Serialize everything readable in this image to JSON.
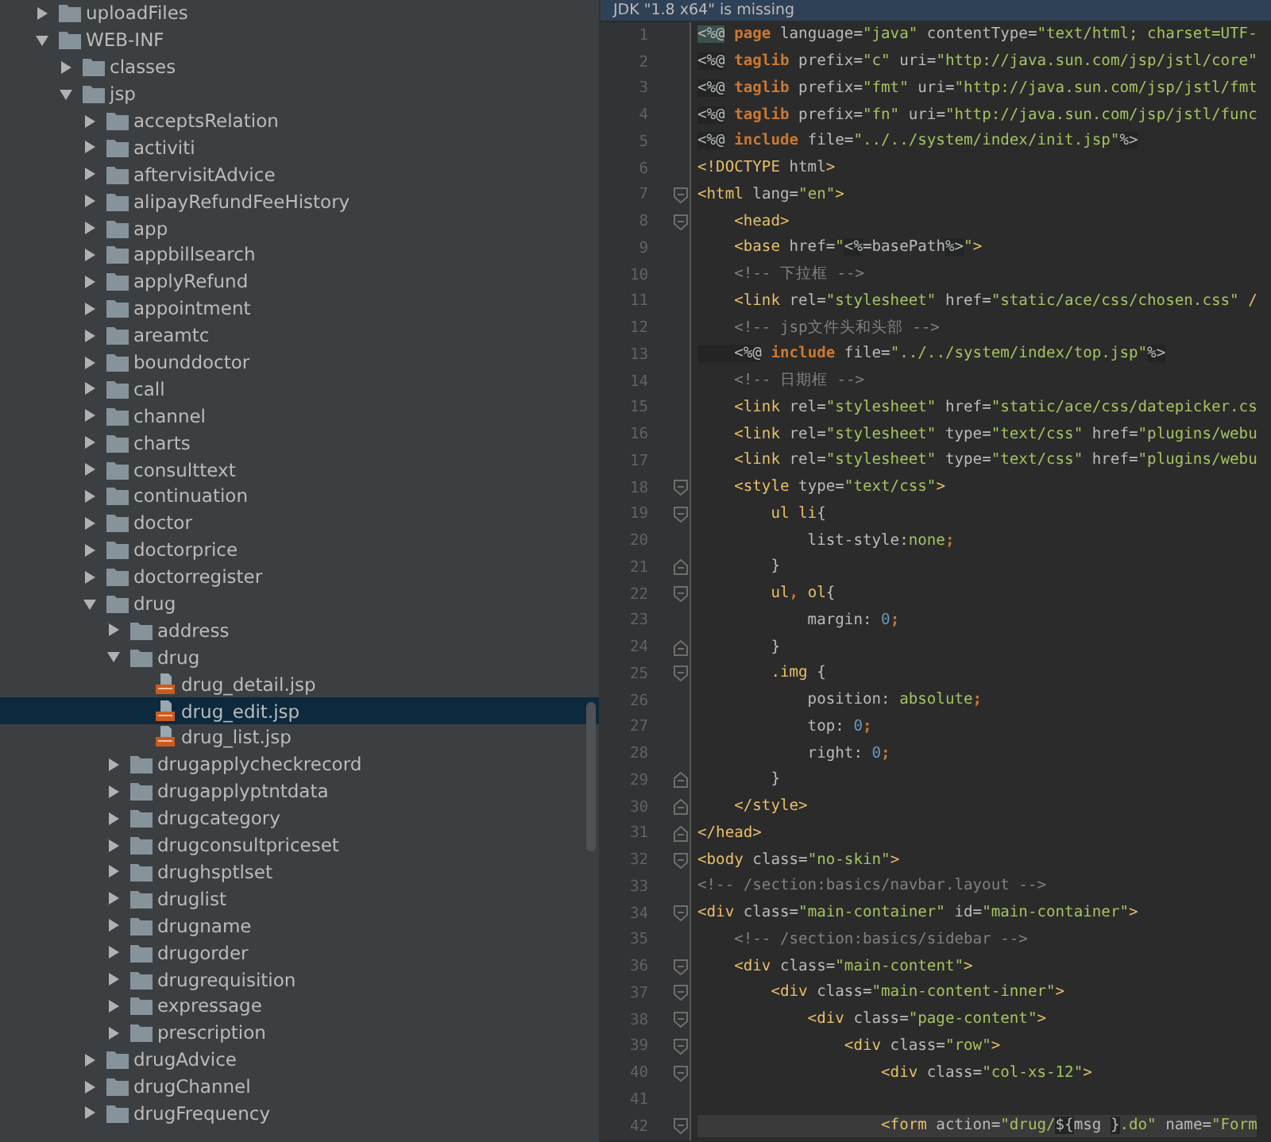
{
  "project_tree": {
    "items": [
      {
        "name": "uploadFiles",
        "kind": "folder",
        "expanded": false,
        "selected": false
      },
      {
        "name": "WEB-INF",
        "kind": "folder",
        "expanded": true,
        "selected": false,
        "children": [
          {
            "name": "classes",
            "kind": "folder",
            "expanded": false,
            "selected": false
          },
          {
            "name": "jsp",
            "kind": "folder",
            "expanded": true,
            "selected": false,
            "children": [
              {
                "name": "acceptsRelation",
                "kind": "folder",
                "expanded": false,
                "selected": false
              },
              {
                "name": "activiti",
                "kind": "folder",
                "expanded": false,
                "selected": false
              },
              {
                "name": "aftervisitAdvice",
                "kind": "folder",
                "expanded": false,
                "selected": false
              },
              {
                "name": "alipayRefundFeeHistory",
                "kind": "folder",
                "expanded": false,
                "selected": false
              },
              {
                "name": "app",
                "kind": "folder",
                "expanded": false,
                "selected": false
              },
              {
                "name": "appbillsearch",
                "kind": "folder",
                "expanded": false,
                "selected": false
              },
              {
                "name": "applyRefund",
                "kind": "folder",
                "expanded": false,
                "selected": false
              },
              {
                "name": "appointment",
                "kind": "folder",
                "expanded": false,
                "selected": false
              },
              {
                "name": "areamtc",
                "kind": "folder",
                "expanded": false,
                "selected": false
              },
              {
                "name": "bounddoctor",
                "kind": "folder",
                "expanded": false,
                "selected": false
              },
              {
                "name": "call",
                "kind": "folder",
                "expanded": false,
                "selected": false
              },
              {
                "name": "channel",
                "kind": "folder",
                "expanded": false,
                "selected": false
              },
              {
                "name": "charts",
                "kind": "folder",
                "expanded": false,
                "selected": false
              },
              {
                "name": "consulttext",
                "kind": "folder",
                "expanded": false,
                "selected": false
              },
              {
                "name": "continuation",
                "kind": "folder",
                "expanded": false,
                "selected": false
              },
              {
                "name": "doctor",
                "kind": "folder",
                "expanded": false,
                "selected": false
              },
              {
                "name": "doctorprice",
                "kind": "folder",
                "expanded": false,
                "selected": false
              },
              {
                "name": "doctorregister",
                "kind": "folder",
                "expanded": false,
                "selected": false
              },
              {
                "name": "drug",
                "kind": "folder",
                "expanded": true,
                "selected": false,
                "children": [
                  {
                    "name": "address",
                    "kind": "folder",
                    "expanded": false,
                    "selected": false
                  },
                  {
                    "name": "drug",
                    "kind": "folder",
                    "expanded": true,
                    "selected": false,
                    "children": [
                      {
                        "name": "drug_detail.jsp",
                        "kind": "jsp",
                        "selected": false
                      },
                      {
                        "name": "drug_edit.jsp",
                        "kind": "jsp",
                        "selected": true
                      },
                      {
                        "name": "drug_list.jsp",
                        "kind": "jsp",
                        "selected": false
                      }
                    ]
                  },
                  {
                    "name": "drugapplycheckrecord",
                    "kind": "folder",
                    "expanded": false,
                    "selected": false
                  },
                  {
                    "name": "drugapplyptntdata",
                    "kind": "folder",
                    "expanded": false,
                    "selected": false
                  },
                  {
                    "name": "drugcategory",
                    "kind": "folder",
                    "expanded": false,
                    "selected": false
                  },
                  {
                    "name": "drugconsultpriceset",
                    "kind": "folder",
                    "expanded": false,
                    "selected": false
                  },
                  {
                    "name": "drughsptlset",
                    "kind": "folder",
                    "expanded": false,
                    "selected": false
                  },
                  {
                    "name": "druglist",
                    "kind": "folder",
                    "expanded": false,
                    "selected": false
                  },
                  {
                    "name": "drugname",
                    "kind": "folder",
                    "expanded": false,
                    "selected": false
                  },
                  {
                    "name": "drugorder",
                    "kind": "folder",
                    "expanded": false,
                    "selected": false
                  },
                  {
                    "name": "drugrequisition",
                    "kind": "folder",
                    "expanded": false,
                    "selected": false
                  },
                  {
                    "name": "expressage",
                    "kind": "folder",
                    "expanded": false,
                    "selected": false
                  },
                  {
                    "name": "prescription",
                    "kind": "folder",
                    "expanded": false,
                    "selected": false
                  }
                ]
              },
              {
                "name": "drugAdvice",
                "kind": "folder",
                "expanded": false,
                "selected": false
              },
              {
                "name": "drugChannel",
                "kind": "folder",
                "expanded": false,
                "selected": false
              },
              {
                "name": "drugFrequency",
                "kind": "folder",
                "expanded": false,
                "selected": false
              }
            ]
          }
        ]
      }
    ]
  },
  "editor": {
    "banner": "JDK \"1.8 x64\" is missing",
    "lines": [
      {
        "number": "1",
        "fold_start": false,
        "fold_end": false,
        "tokens": [
          {
            "kind": "match",
            "text": "<%@"
          },
          {
            "kind": "keyword",
            "text": " page"
          },
          {
            "kind": "attr",
            "text": " language="
          },
          {
            "kind": "string",
            "text": "\"java\""
          },
          {
            "kind": "attr",
            "text": " contentType="
          },
          {
            "kind": "string",
            "text": "\"text/html; charset=UTF-"
          }
        ]
      },
      {
        "number": "2",
        "fold_start": false,
        "fold_end": false,
        "tokens": [
          {
            "kind": "directive",
            "text": "<%@"
          },
          {
            "kind": "keyword",
            "text": " taglib"
          },
          {
            "kind": "attr",
            "text": " prefix="
          },
          {
            "kind": "string",
            "text": "\"c\""
          },
          {
            "kind": "attr",
            "text": " uri="
          },
          {
            "kind": "string",
            "text": "\"http://java.sun.com/jsp/jstl/core\""
          }
        ]
      },
      {
        "number": "3",
        "fold_start": false,
        "fold_end": false,
        "tokens": [
          {
            "kind": "directive",
            "text": "<%@"
          },
          {
            "kind": "keyword",
            "text": " taglib"
          },
          {
            "kind": "attr",
            "text": " prefix="
          },
          {
            "kind": "string",
            "text": "\"fmt\""
          },
          {
            "kind": "attr",
            "text": " uri="
          },
          {
            "kind": "string",
            "text": "\"http://java.sun.com/jsp/jstl/fmt"
          }
        ]
      },
      {
        "number": "4",
        "fold_start": false,
        "fold_end": false,
        "tokens": [
          {
            "kind": "directive",
            "text": "<%@"
          },
          {
            "kind": "keyword",
            "text": " taglib"
          },
          {
            "kind": "attr",
            "text": " prefix="
          },
          {
            "kind": "string",
            "text": "\"fn\""
          },
          {
            "kind": "attr",
            "text": " uri="
          },
          {
            "kind": "string",
            "text": "\"http://java.sun.com/jsp/jstl/func"
          }
        ]
      },
      {
        "number": "5",
        "fold_start": false,
        "fold_end": false,
        "tokens": [
          {
            "kind": "directive",
            "text": "<%@"
          },
          {
            "kind": "keyword",
            "text": " include"
          },
          {
            "kind": "attr",
            "text": " file="
          },
          {
            "kind": "string",
            "text": "\"../../system/index/init.jsp\""
          },
          {
            "kind": "directive",
            "text": "%>"
          }
        ]
      },
      {
        "number": "6",
        "fold_start": false,
        "fold_end": false,
        "tokens": [
          {
            "kind": "tag",
            "text": "<!DOCTYPE"
          },
          {
            "kind": "attr",
            "text": " html"
          },
          {
            "kind": "tag",
            "text": ">"
          }
        ]
      },
      {
        "number": "7",
        "fold_start": true,
        "fold_end": false,
        "tokens": [
          {
            "kind": "tag",
            "text": "<html"
          },
          {
            "kind": "attr",
            "text": " lang="
          },
          {
            "kind": "string",
            "text": "\"en\""
          },
          {
            "kind": "tag",
            "text": ">"
          }
        ]
      },
      {
        "number": "8",
        "fold_start": true,
        "fold_end": false,
        "tokens": [
          {
            "kind": "tag",
            "text": "    <head>"
          }
        ]
      },
      {
        "number": "9",
        "fold_start": false,
        "fold_end": false,
        "tokens": [
          {
            "kind": "tag",
            "text": "    <base"
          },
          {
            "kind": "attr",
            "text": " href="
          },
          {
            "kind": "string",
            "text": "\""
          },
          {
            "kind": "directive",
            "text": "<%"
          },
          {
            "kind": "attr",
            "text": "=basePath"
          },
          {
            "kind": "directive",
            "text": "%>"
          },
          {
            "kind": "string",
            "text": "\""
          },
          {
            "kind": "tag",
            "text": ">"
          }
        ]
      },
      {
        "number": "10",
        "fold_start": false,
        "fold_end": false,
        "tokens": [
          {
            "kind": "comment",
            "text": "    <!-- 下拉框 -->"
          }
        ]
      },
      {
        "number": "11",
        "fold_start": false,
        "fold_end": false,
        "tokens": [
          {
            "kind": "tag",
            "text": "    <link"
          },
          {
            "kind": "attr",
            "text": " rel="
          },
          {
            "kind": "string",
            "text": "\"stylesheet\""
          },
          {
            "kind": "attr",
            "text": " href="
          },
          {
            "kind": "string",
            "text": "\"static/ace/css/chosen.css\""
          },
          {
            "kind": "tag",
            "text": " /"
          }
        ]
      },
      {
        "number": "12",
        "fold_start": false,
        "fold_end": false,
        "tokens": [
          {
            "kind": "comment",
            "text": "    <!-- jsp文件头和头部 -->"
          }
        ]
      },
      {
        "number": "13",
        "fold_start": false,
        "fold_end": false,
        "tokens": [
          {
            "kind": "directive",
            "text": "    <%@"
          },
          {
            "kind": "keyword",
            "text": " include"
          },
          {
            "kind": "attr",
            "text": " file="
          },
          {
            "kind": "string",
            "text": "\"../../system/index/top.jsp\""
          },
          {
            "kind": "directive",
            "text": "%>"
          }
        ]
      },
      {
        "number": "14",
        "fold_start": false,
        "fold_end": false,
        "tokens": [
          {
            "kind": "comment",
            "text": "    <!-- 日期框 -->"
          }
        ]
      },
      {
        "number": "15",
        "fold_start": false,
        "fold_end": false,
        "tokens": [
          {
            "kind": "tag",
            "text": "    <link"
          },
          {
            "kind": "attr",
            "text": " rel="
          },
          {
            "kind": "string",
            "text": "\"stylesheet\""
          },
          {
            "kind": "attr",
            "text": " href="
          },
          {
            "kind": "string",
            "text": "\"static/ace/css/datepicker.cs"
          }
        ]
      },
      {
        "number": "16",
        "fold_start": false,
        "fold_end": false,
        "tokens": [
          {
            "kind": "tag",
            "text": "    <link"
          },
          {
            "kind": "attr",
            "text": " rel="
          },
          {
            "kind": "string",
            "text": "\"stylesheet\""
          },
          {
            "kind": "attr",
            "text": " type="
          },
          {
            "kind": "string",
            "text": "\"text/css\""
          },
          {
            "kind": "attr",
            "text": " href="
          },
          {
            "kind": "string",
            "text": "\"plugins/webu"
          }
        ]
      },
      {
        "number": "17",
        "fold_start": false,
        "fold_end": false,
        "tokens": [
          {
            "kind": "tag",
            "text": "    <link"
          },
          {
            "kind": "attr",
            "text": " rel="
          },
          {
            "kind": "string",
            "text": "\"stylesheet\""
          },
          {
            "kind": "attr",
            "text": " type="
          },
          {
            "kind": "string",
            "text": "\"text/css\""
          },
          {
            "kind": "attr",
            "text": " href="
          },
          {
            "kind": "string",
            "text": "\"plugins/webu"
          }
        ]
      },
      {
        "number": "18",
        "fold_start": true,
        "fold_end": false,
        "tokens": [
          {
            "kind": "tag",
            "text": "    <style"
          },
          {
            "kind": "attr",
            "text": " type="
          },
          {
            "kind": "string",
            "text": "\"text/css\""
          },
          {
            "kind": "tag",
            "text": ">"
          }
        ]
      },
      {
        "number": "19",
        "fold_start": true,
        "fold_end": false,
        "tokens": [
          {
            "kind": "tag",
            "text": "        ul li"
          },
          {
            "kind": "attr",
            "text": "{"
          }
        ]
      },
      {
        "number": "20",
        "fold_start": false,
        "fold_end": false,
        "tokens": [
          {
            "kind": "attr",
            "text": "            list-style:"
          },
          {
            "kind": "string",
            "text": "none"
          },
          {
            "kind": "keyword",
            "text": ";"
          }
        ]
      },
      {
        "number": "21",
        "fold_start": false,
        "fold_end": true,
        "tokens": [
          {
            "kind": "attr",
            "text": "        }"
          }
        ]
      },
      {
        "number": "22",
        "fold_start": true,
        "fold_end": false,
        "tokens": [
          {
            "kind": "tag",
            "text": "        ul"
          },
          {
            "kind": "keyword",
            "text": ","
          },
          {
            "kind": "tag",
            "text": " ol"
          },
          {
            "kind": "attr",
            "text": "{"
          }
        ]
      },
      {
        "number": "23",
        "fold_start": false,
        "fold_end": false,
        "tokens": [
          {
            "kind": "attr",
            "text": "            margin: "
          },
          {
            "kind": "number",
            "text": "0"
          },
          {
            "kind": "keyword",
            "text": ";"
          }
        ]
      },
      {
        "number": "24",
        "fold_start": false,
        "fold_end": true,
        "tokens": [
          {
            "kind": "attr",
            "text": "        }"
          }
        ]
      },
      {
        "number": "25",
        "fold_start": true,
        "fold_end": false,
        "tokens": [
          {
            "kind": "tag",
            "text": "        .img"
          },
          {
            "kind": "attr",
            "text": " {"
          }
        ]
      },
      {
        "number": "26",
        "fold_start": false,
        "fold_end": false,
        "tokens": [
          {
            "kind": "attr",
            "text": "            position: "
          },
          {
            "kind": "string",
            "text": "absolute"
          },
          {
            "kind": "keyword",
            "text": ";"
          }
        ]
      },
      {
        "number": "27",
        "fold_start": false,
        "fold_end": false,
        "tokens": [
          {
            "kind": "attr",
            "text": "            top: "
          },
          {
            "kind": "number",
            "text": "0"
          },
          {
            "kind": "keyword",
            "text": ";"
          }
        ]
      },
      {
        "number": "28",
        "fold_start": false,
        "fold_end": false,
        "tokens": [
          {
            "kind": "attr",
            "text": "            right: "
          },
          {
            "kind": "number",
            "text": "0"
          },
          {
            "kind": "keyword",
            "text": ";"
          }
        ]
      },
      {
        "number": "29",
        "fold_start": false,
        "fold_end": true,
        "tokens": [
          {
            "kind": "attr",
            "text": "        }"
          }
        ]
      },
      {
        "number": "30",
        "fold_start": false,
        "fold_end": true,
        "tokens": [
          {
            "kind": "tag",
            "text": "    </style>"
          }
        ]
      },
      {
        "number": "31",
        "fold_start": false,
        "fold_end": true,
        "tokens": [
          {
            "kind": "tag",
            "text": "</head>"
          }
        ]
      },
      {
        "number": "32",
        "fold_start": true,
        "fold_end": false,
        "tokens": [
          {
            "kind": "tag",
            "text": "<body"
          },
          {
            "kind": "attr",
            "text": " class="
          },
          {
            "kind": "string",
            "text": "\"no-skin\""
          },
          {
            "kind": "tag",
            "text": ">"
          }
        ]
      },
      {
        "number": "33",
        "fold_start": false,
        "fold_end": false,
        "tokens": [
          {
            "kind": "comment",
            "text": "<!-- /section:basics/navbar.layout -->"
          }
        ]
      },
      {
        "number": "34",
        "fold_start": true,
        "fold_end": false,
        "tokens": [
          {
            "kind": "tag",
            "text": "<div"
          },
          {
            "kind": "attr",
            "text": " class="
          },
          {
            "kind": "string",
            "text": "\"main-container\""
          },
          {
            "kind": "attr",
            "text": " id="
          },
          {
            "kind": "string",
            "text": "\"main-container\""
          },
          {
            "kind": "tag",
            "text": ">"
          }
        ]
      },
      {
        "number": "35",
        "fold_start": false,
        "fold_end": false,
        "tokens": [
          {
            "kind": "comment",
            "text": "    <!-- /section:basics/sidebar -->"
          }
        ]
      },
      {
        "number": "36",
        "fold_start": true,
        "fold_end": false,
        "tokens": [
          {
            "kind": "tag",
            "text": "    <div"
          },
          {
            "kind": "attr",
            "text": " class="
          },
          {
            "kind": "string",
            "text": "\"main-content\""
          },
          {
            "kind": "tag",
            "text": ">"
          }
        ]
      },
      {
        "number": "37",
        "fold_start": true,
        "fold_end": false,
        "tokens": [
          {
            "kind": "tag",
            "text": "        <div"
          },
          {
            "kind": "attr",
            "text": " class="
          },
          {
            "kind": "string",
            "text": "\"main-content-inner\""
          },
          {
            "kind": "tag",
            "text": ">"
          }
        ]
      },
      {
        "number": "38",
        "fold_start": true,
        "fold_end": false,
        "tokens": [
          {
            "kind": "tag",
            "text": "            <div"
          },
          {
            "kind": "attr",
            "text": " class="
          },
          {
            "kind": "string",
            "text": "\"page-content\""
          },
          {
            "kind": "tag",
            "text": ">"
          }
        ]
      },
      {
        "number": "39",
        "fold_start": true,
        "fold_end": false,
        "tokens": [
          {
            "kind": "tag",
            "text": "                <div"
          },
          {
            "kind": "attr",
            "text": " class="
          },
          {
            "kind": "string",
            "text": "\"row\""
          },
          {
            "kind": "tag",
            "text": ">"
          }
        ]
      },
      {
        "number": "40",
        "fold_start": true,
        "fold_end": false,
        "tokens": [
          {
            "kind": "tag",
            "text": "                    <div"
          },
          {
            "kind": "attr",
            "text": " class="
          },
          {
            "kind": "string",
            "text": "\"col-xs-12\""
          },
          {
            "kind": "tag",
            "text": ">"
          }
        ]
      },
      {
        "number": "41",
        "fold_start": false,
        "fold_end": false
      },
      {
        "number": "42",
        "fold_start": true,
        "fold_end": false,
        "current": true,
        "tokens": [
          {
            "kind": "tag",
            "text": "                    <form"
          },
          {
            "kind": "attr",
            "text": " action="
          },
          {
            "kind": "string",
            "text": "\"drug/"
          },
          {
            "kind": "directive",
            "text": "${"
          },
          {
            "kind": "attr",
            "text": "msg "
          },
          {
            "kind": "directive",
            "text": "}"
          },
          {
            "kind": "string",
            "text": ".do\""
          },
          {
            "kind": "attr",
            "text": " name="
          },
          {
            "kind": "string",
            "text": "\"Form"
          }
        ]
      }
    ]
  }
}
